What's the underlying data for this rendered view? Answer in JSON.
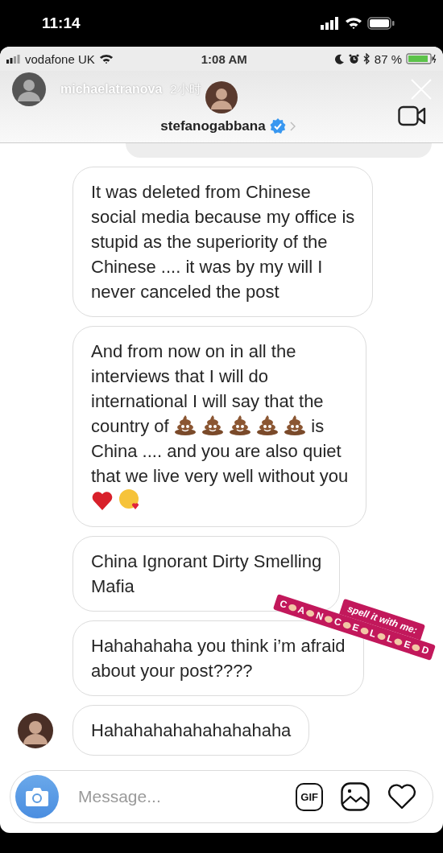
{
  "status_bar": {
    "time": "11:14"
  },
  "inner_status_bar": {
    "carrier": "vodafone UK",
    "time": "1:08 AM",
    "battery": "87 %"
  },
  "story_header": {
    "username": "michaelatranova",
    "age": "2小时"
  },
  "chat_header": {
    "username": "stefanogabbana",
    "verified": true
  },
  "messages": [
    {
      "show_avatar": false,
      "blocks": [
        [
          {
            "kind": "text",
            "text": "It was deleted from Chinese\nsocial media because my office is\nstupid as the superiority of the\nChinese .... it was by my will I\nnever canceled the post"
          }
        ]
      ]
    },
    {
      "show_avatar": false,
      "blocks": [
        [
          {
            "kind": "text",
            "text": "And from now on in all the\ninterviews that I will do\ninternational I will say that the"
          }
        ],
        [
          {
            "kind": "text",
            "text": "country of"
          },
          {
            "kind": "poop"
          },
          {
            "kind": "poop"
          },
          {
            "kind": "poop"
          },
          {
            "kind": "poop"
          },
          {
            "kind": "poop"
          },
          {
            "kind": "text",
            "text": "is"
          }
        ],
        [
          {
            "kind": "text",
            "text": "China .... and you are also quiet\nthat we live very well without you"
          }
        ],
        [
          {
            "kind": "heart"
          },
          {
            "kind": "kiss"
          }
        ]
      ]
    },
    {
      "show_avatar": false,
      "blocks": [
        [
          {
            "kind": "text",
            "text": "China Ignorant Dirty Smelling\nMafia"
          }
        ]
      ]
    },
    {
      "show_avatar": false,
      "blocks": [
        [
          {
            "kind": "text",
            "text": "Hahahahaha you think i’m afraid\nabout your post????"
          }
        ]
      ]
    },
    {
      "show_avatar": true,
      "blocks": [
        [
          {
            "kind": "text",
            "text": "Hahahahahahahahahaha"
          }
        ]
      ]
    }
  ],
  "sticker": {
    "title": "spell it with me:",
    "letters": [
      "C",
      "A",
      "N",
      "C",
      "E",
      "L",
      "L",
      "E",
      "D"
    ]
  },
  "composer": {
    "placeholder": "Message...",
    "gif_label": "GIF"
  }
}
